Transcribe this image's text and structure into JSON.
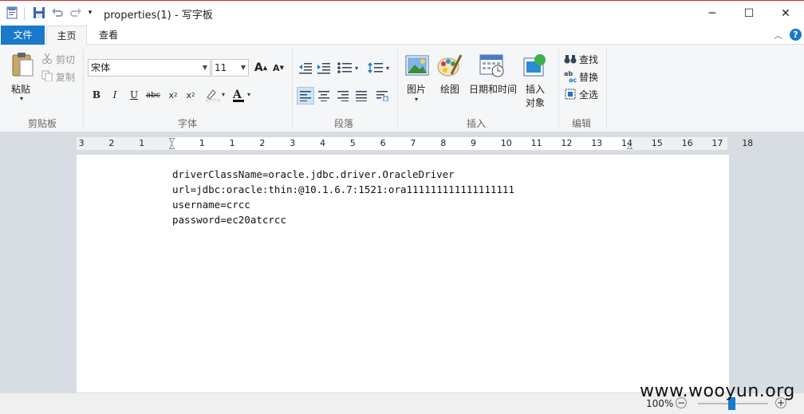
{
  "window": {
    "title": "properties(1) - 写字板",
    "controls": {
      "minimize": "─",
      "maximize": "☐",
      "close": "✕"
    }
  },
  "tabs": [
    {
      "label": "文件"
    },
    {
      "label": "主页"
    },
    {
      "label": "查看"
    }
  ],
  "ribbon": {
    "clipboard": {
      "group": "剪贴板",
      "paste": "粘贴",
      "cut": "剪切",
      "copy": "复制"
    },
    "font": {
      "group": "字体",
      "family": "宋体",
      "size": "11"
    },
    "paragraph": {
      "group": "段落"
    },
    "insert": {
      "group": "插入",
      "picture": "图片",
      "paint": "绘图",
      "datetime": "日期和时间",
      "object_line1": "插入",
      "object_line2": "对象"
    },
    "editing": {
      "group": "编辑",
      "find": "查找",
      "replace": "替换",
      "select_all": "全选"
    }
  },
  "ruler": {
    "labels": [
      "3",
      "2",
      "1",
      "1",
      "1",
      "2",
      "3",
      "4",
      "5",
      "6",
      "7",
      "8",
      "9",
      "10",
      "11",
      "12",
      "13",
      "14",
      "15",
      "16",
      "17",
      "18"
    ]
  },
  "document": {
    "lines": [
      "driverClassName=oracle.jdbc.driver.OracleDriver",
      "url=jdbc:oracle:thin:@10.1.6.7:1521:ora111111111111111111",
      "username=crcc",
      "password=ec20atcrcc"
    ]
  },
  "status": {
    "zoom": "100%"
  },
  "watermark": "www.wooyun.org",
  "colors": {
    "accent": "#1979ca",
    "ribbon_bg": "#f5f6f7",
    "doc_bg": "#d8dde3"
  }
}
